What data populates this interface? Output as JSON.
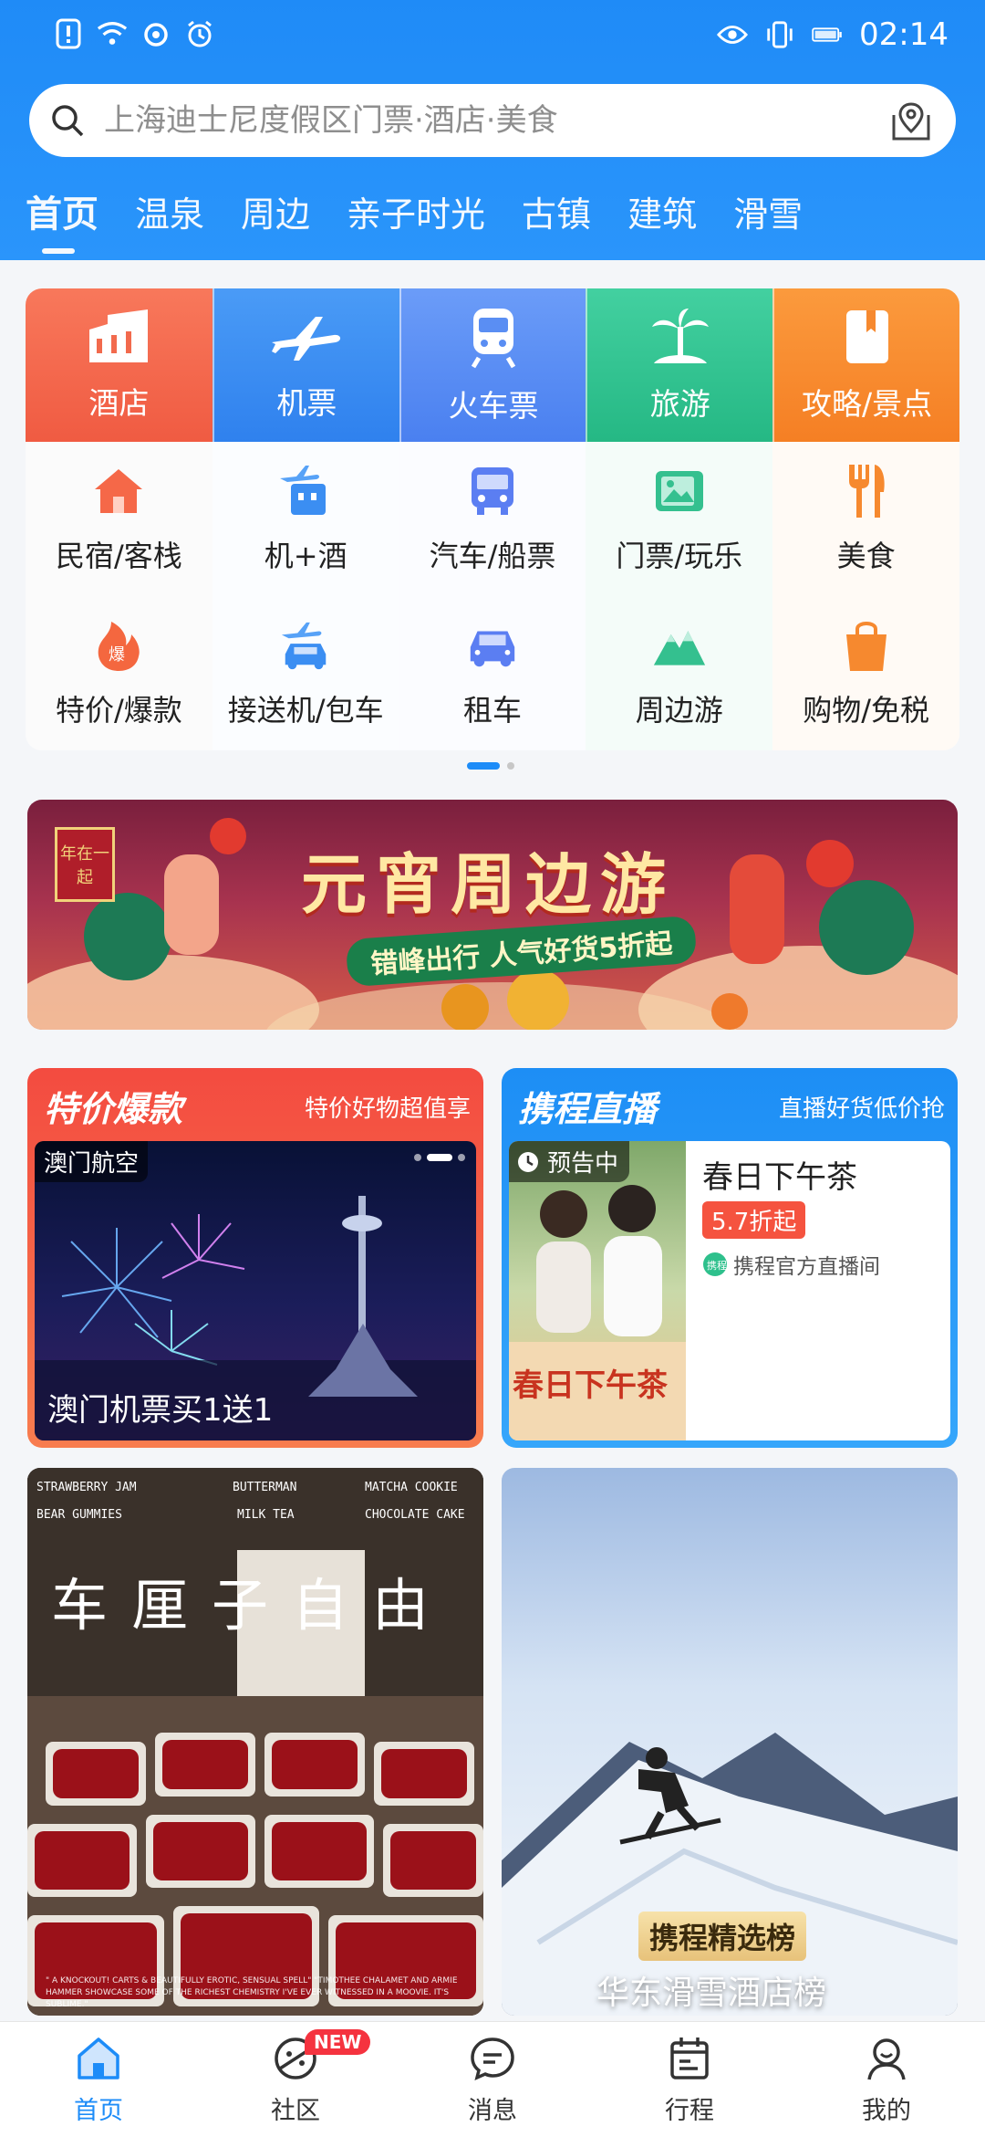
{
  "status_bar": {
    "time": "02:14"
  },
  "search": {
    "placeholder": "上海迪士尼度假区门票·酒店·美食"
  },
  "tabs": [
    "首页",
    "温泉",
    "周边",
    "亲子时光",
    "古镇",
    "建筑",
    "滑雪"
  ],
  "big_categories": [
    {
      "label": "酒店",
      "icon": "hotel-icon",
      "color": "#f3654a"
    },
    {
      "label": "机票",
      "icon": "plane-icon",
      "color": "#3b8ef2"
    },
    {
      "label": "火车票",
      "icon": "train-icon",
      "color": "#4f86f4"
    },
    {
      "label": "旅游",
      "icon": "palm-tree-icon",
      "color": "#34c38f"
    },
    {
      "label": "攻略/景点",
      "icon": "guidebook-icon",
      "color": "#f68a2f"
    }
  ],
  "small_categories": [
    {
      "label": "民宿/客栈",
      "icon": "homestay-icon"
    },
    {
      "label": "机+酒",
      "icon": "flight-hotel-icon"
    },
    {
      "label": "汽车/船票",
      "icon": "bus-icon"
    },
    {
      "label": "门票/玩乐",
      "icon": "ticket-icon"
    },
    {
      "label": "美食",
      "icon": "cutlery-icon"
    },
    {
      "label": "特价/爆款",
      "icon": "hot-deal-icon"
    },
    {
      "label": "接送机/包车",
      "icon": "car-plane-icon"
    },
    {
      "label": "租车",
      "icon": "car-icon"
    },
    {
      "label": "周边游",
      "icon": "mountain-icon"
    },
    {
      "label": "购物/免税",
      "icon": "shopping-bag-icon"
    }
  ],
  "banner": {
    "badge": "年在一起",
    "title": "元宵周边游",
    "subtitle": "错峰出行 人气好货5折起"
  },
  "deals_card": {
    "title": "特价爆款",
    "subtitle": "特价好物超值享",
    "tag": "澳门航空",
    "caption": "澳门机票买1送1"
  },
  "live_card": {
    "title": "携程直播",
    "subtitle": "直播好货低价抢",
    "tag": "预告中",
    "item_title": "春日下午茶",
    "discount": "5.7折起",
    "channel": "携程官方直播间",
    "poster_text": "春日下午茶"
  },
  "feed_left": {
    "menu_items": [
      "STRAWBERRY JAM",
      "BUTTERMAN",
      "MATCHA COOKIE",
      "BEAR GUMMIES",
      "MILK TEA",
      "CHOCOLATE CAKE"
    ],
    "headline": "车厘子自由",
    "quote": "\" A KNOCKOUT! CARTS & BEAUTIFULLY EROTIC, SENSUAL SPELL\" \"TIMOTHEE CHALAMET AND ARMIE HAMMER SHOWCASE SOME OF THE RICHEST CHEMISTRY I'VE EVER WITNESSED IN A MOOVIE. IT'S SUBLIME.\""
  },
  "feed_right": {
    "badge": "携程精选榜",
    "caption": "华东滑雪酒店榜"
  },
  "bottom_nav": [
    {
      "label": "首页",
      "icon": "home-icon"
    },
    {
      "label": "社区",
      "icon": "community-icon",
      "badge": "NEW"
    },
    {
      "label": "消息",
      "icon": "message-icon"
    },
    {
      "label": "行程",
      "icon": "itinerary-icon"
    },
    {
      "label": "我的",
      "icon": "profile-icon"
    }
  ]
}
